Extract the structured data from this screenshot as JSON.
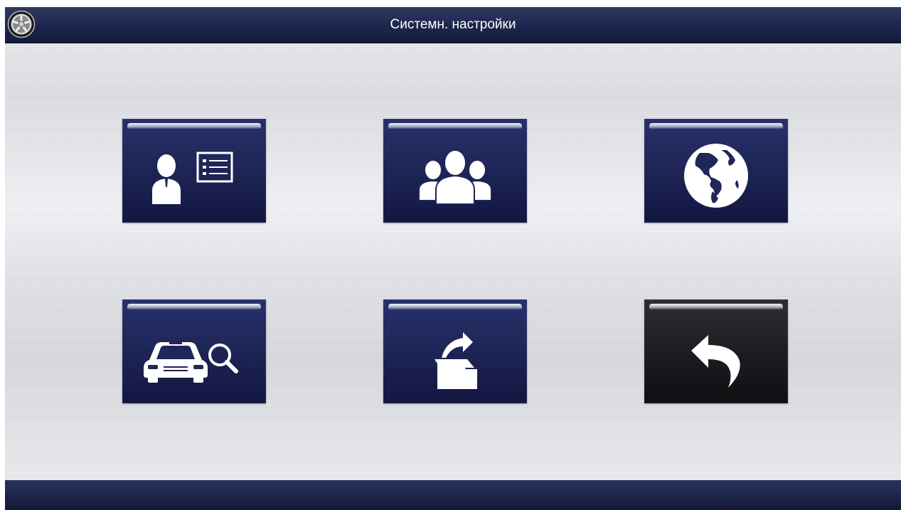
{
  "header": {
    "title": "Системн. настройки",
    "logo_icon": "wheel-rim-icon"
  },
  "tiles": [
    {
      "name": "user-profile-tile",
      "icon": "user-card-icon",
      "style": "blue"
    },
    {
      "name": "user-group-tile",
      "icon": "user-group-icon",
      "style": "blue"
    },
    {
      "name": "language-tile",
      "icon": "globe-icon",
      "style": "blue"
    },
    {
      "name": "vehicle-search-tile",
      "icon": "car-search-icon",
      "style": "blue"
    },
    {
      "name": "export-files-tile",
      "icon": "folder-export-icon",
      "style": "blue"
    },
    {
      "name": "back-tile",
      "icon": "back-arrow-icon",
      "style": "dark"
    }
  ],
  "colors": {
    "bar": "#1f2850",
    "tile": "#1f2658",
    "tile_dark": "#1d1d22",
    "background": "#e2e4e9"
  }
}
